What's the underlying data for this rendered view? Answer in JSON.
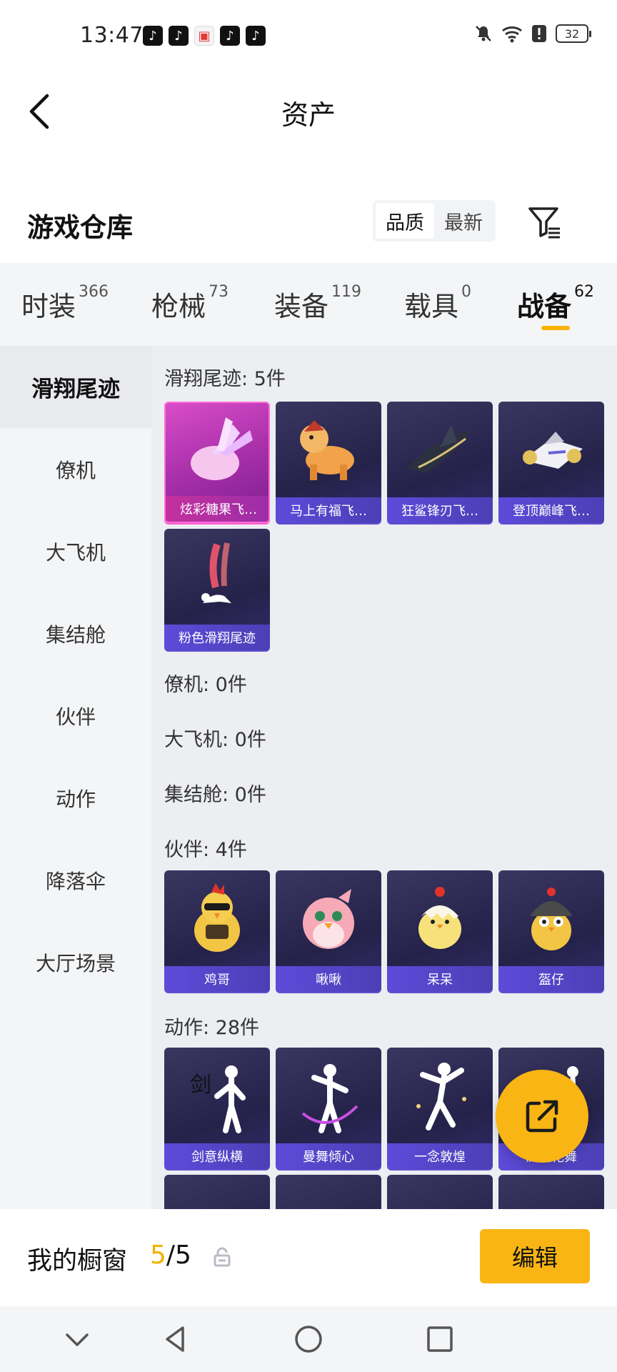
{
  "status_bar": {
    "time": "13:47",
    "apps": [
      "tiktok-icon",
      "tiktok-icon",
      "box-app-icon",
      "tiktok-icon",
      "tiktok-icon"
    ],
    "battery": "32",
    "icons": [
      "mute-bell-icon",
      "wifi-icon",
      "alert-icon"
    ]
  },
  "header": {
    "title": "资产"
  },
  "warehouse": {
    "title": "游戏仓库",
    "sort_options": [
      "品质",
      "最新"
    ],
    "active_sort": "品质"
  },
  "category_tabs": [
    {
      "label": "时装",
      "count": "366"
    },
    {
      "label": "枪械",
      "count": "73"
    },
    {
      "label": "装备",
      "count": "119"
    },
    {
      "label": "载具",
      "count": "0"
    },
    {
      "label": "战备",
      "count": "62",
      "active": true
    }
  ],
  "sidebar": {
    "items": [
      "滑翔尾迹",
      "僚机",
      "大飞机",
      "集结舱",
      "伙伴",
      "动作",
      "降落伞",
      "大厅场景"
    ],
    "active": "滑翔尾迹"
  },
  "sections": {
    "glide": {
      "title": "滑翔尾迹: 5件",
      "items": [
        "炫彩糖果飞…",
        "马上有福飞…",
        "狂鲨锋刃飞…",
        "登顶巅峰飞…",
        "粉色滑翔尾迹"
      ]
    },
    "wingman": {
      "title": "僚机: 0件"
    },
    "plane": {
      "title": "大飞机: 0件"
    },
    "pod": {
      "title": "集结舱: 0件"
    },
    "partner": {
      "title": "伙伴: 4件",
      "items": [
        "鸡哥",
        "啾啾",
        "呆呆",
        "盔仔"
      ]
    },
    "emote": {
      "title": "动作: 28件",
      "items": [
        "剑意纵横",
        "曼舞倾心",
        "一念敦煌",
        "流光花舞"
      ]
    }
  },
  "showcase": {
    "title": "我的橱窗",
    "current": "5",
    "separator": "/",
    "total": "5",
    "edit_label": "编辑"
  },
  "colors": {
    "accent": "#f8b514",
    "card_bg": "#2b2752",
    "card_label": "#5d4bd9",
    "card_highlight": "#d94cc9"
  }
}
